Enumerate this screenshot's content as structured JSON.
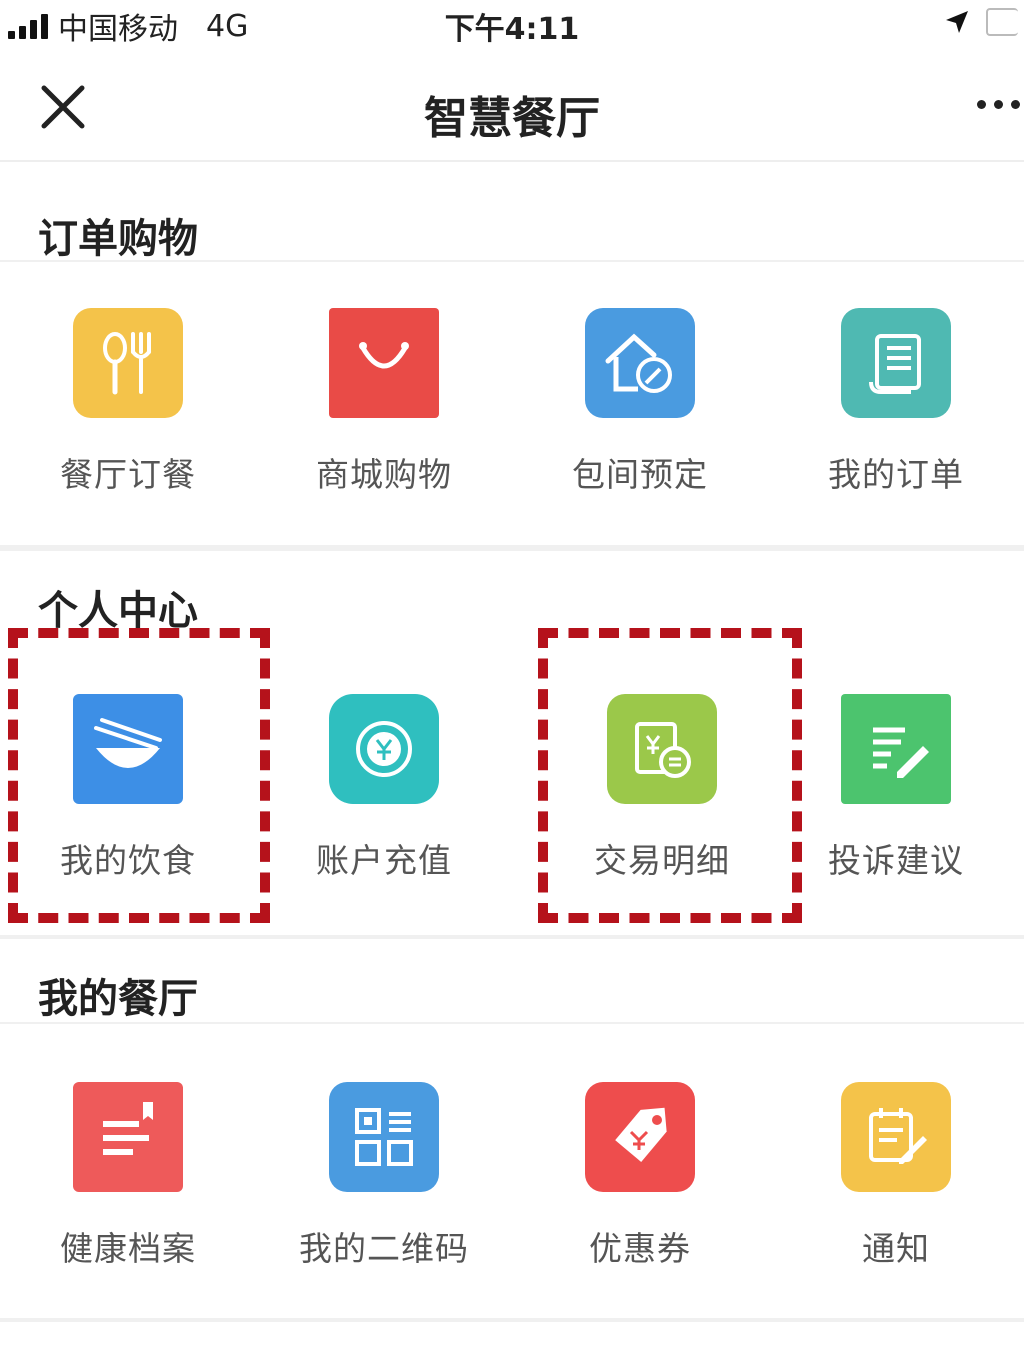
{
  "status_bar": {
    "carrier": "中国移动",
    "network": "4G",
    "time": "下午4:11"
  },
  "nav": {
    "title": "智慧餐厅",
    "close_icon": "close-icon",
    "more_icon": "more-icon"
  },
  "sections": [
    {
      "title": "订单购物",
      "items": [
        {
          "label": "餐厅订餐",
          "icon": "fork-spoon-icon",
          "color": "#F4C34A"
        },
        {
          "label": "商城购物",
          "icon": "shopping-bag-icon",
          "color": "#E94B47"
        },
        {
          "label": "包间预定",
          "icon": "house-key-icon",
          "color": "#4A9BE0"
        },
        {
          "label": "我的订单",
          "icon": "scroll-list-icon",
          "color": "#4FB9B2"
        }
      ]
    },
    {
      "title": "个人中心",
      "items": [
        {
          "label": "我的饮食",
          "icon": "bowl-chopsticks-icon",
          "color": "#3D8FE6"
        },
        {
          "label": "账户充值",
          "icon": "yuan-coin-icon",
          "color": "#2FBFBF"
        },
        {
          "label": "交易明细",
          "icon": "transaction-icon",
          "color": "#9BC84A"
        },
        {
          "label": "投诉建议",
          "icon": "document-edit-icon",
          "color": "#4CC46E"
        }
      ]
    },
    {
      "title": "我的餐厅",
      "items": [
        {
          "label": "健康档案",
          "icon": "health-record-icon",
          "color": "#EE5A5A"
        },
        {
          "label": "我的二维码",
          "icon": "qr-code-icon",
          "color": "#4A9BE0"
        },
        {
          "label": "优惠券",
          "icon": "coupon-tag-icon",
          "color": "#EE4D4D"
        },
        {
          "label": "通知",
          "icon": "notice-edit-icon",
          "color": "#F4C34A"
        }
      ]
    }
  ]
}
